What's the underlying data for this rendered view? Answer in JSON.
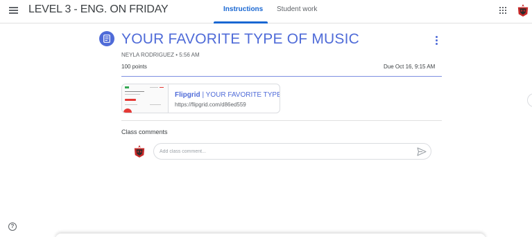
{
  "header": {
    "class_name": "LEVEL 3 - ENG. ON FRIDAY",
    "tabs": [
      {
        "label": "Instructions",
        "active": true
      },
      {
        "label": "Student work",
        "active": false
      }
    ]
  },
  "assignment": {
    "title": "YOUR FAVORITE TYPE OF MUSIC",
    "author": "NEYLA RODRIGUEZ",
    "separator": " • ",
    "posted_time": "5:56 AM",
    "points": "100 points",
    "due": "Due Oct 16, 9:15 AM"
  },
  "attachment": {
    "title_brand": "Flipgrid",
    "title_rest": " | YOUR FAVORITE TYPE",
    "url": "https://flipgrid.com/d86ed559"
  },
  "comments": {
    "label": "Class comments",
    "placeholder": "Add class comment..."
  },
  "icons": {
    "menu": "hamburger-menu-icon",
    "apps": "google-apps-icon",
    "assignment": "assignment-icon",
    "more": "more-vert-icon",
    "send": "send-icon",
    "help": "help-icon",
    "help_glyph": "?"
  },
  "colors": {
    "accent": "#4f6bd8",
    "tab_active": "#1967d2",
    "brand_red": "#c62828"
  }
}
